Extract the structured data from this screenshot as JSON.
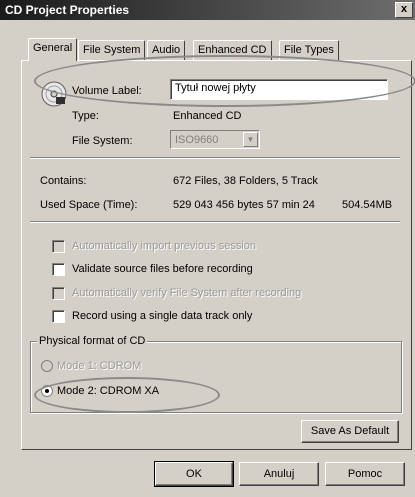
{
  "window": {
    "title": "CD Project Properties",
    "close_label": "x"
  },
  "tabs": [
    {
      "label": "General",
      "active": true
    },
    {
      "label": "File System",
      "active": false
    },
    {
      "label": "Audio",
      "active": false
    },
    {
      "label": "Enhanced CD",
      "active": false
    },
    {
      "label": "File Types",
      "active": false
    }
  ],
  "general": {
    "volume_label_caption": "Volume Label:",
    "volume_label_value": "Tytuł nowej płyty",
    "type_caption": "Type:",
    "type_value": "Enhanced CD",
    "file_system_caption": "File System:",
    "file_system_value": "ISO9660",
    "contains_caption": "Contains:",
    "contains_value": "672 Files, 38 Folders, 5 Track",
    "used_space_caption": "Used Space (Time):",
    "used_space_value": "529 043 456 bytes 57 min 24",
    "used_space_mb": "504.54MB"
  },
  "options": [
    {
      "label": "Automatically import previous session",
      "enabled": false,
      "checked": false
    },
    {
      "label": "Validate source files before recording",
      "enabled": true,
      "checked": false
    },
    {
      "label": "Automatically verify File System after recording",
      "enabled": false,
      "checked": false
    },
    {
      "label": "Record using a single data track only",
      "enabled": true,
      "checked": false
    }
  ],
  "physical_format": {
    "group_label": "Physical format of CD",
    "mode1_label": "Mode 1: CDROM",
    "mode2_label": "Mode 2: CDROM XA",
    "selected": "mode2"
  },
  "buttons": {
    "save_default": "Save As Default",
    "ok": "OK",
    "cancel": "Anuluj",
    "help": "Pomoc"
  }
}
